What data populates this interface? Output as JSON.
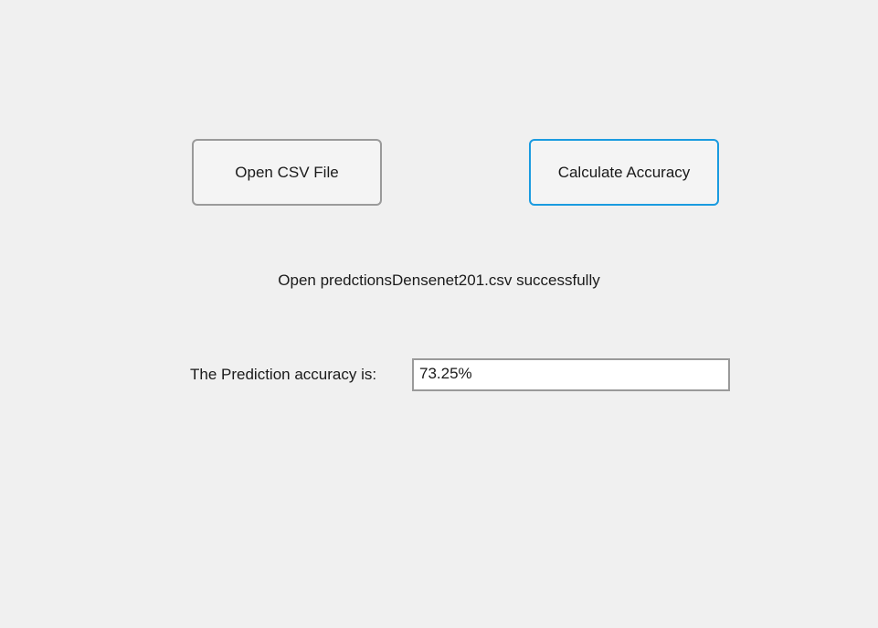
{
  "controls": {
    "open_button_label": "Open CSV File",
    "calculate_button_label": "Calculate Accuracy"
  },
  "status": {
    "message": "Open predctionsDensenet201.csv successfully"
  },
  "result": {
    "label": "The Prediction accuracy is:",
    "value": "73.25%"
  },
  "colors": {
    "background": "#f0f0f0",
    "focused_border": "#1a9be0",
    "default_border": "#9a9a9a"
  }
}
